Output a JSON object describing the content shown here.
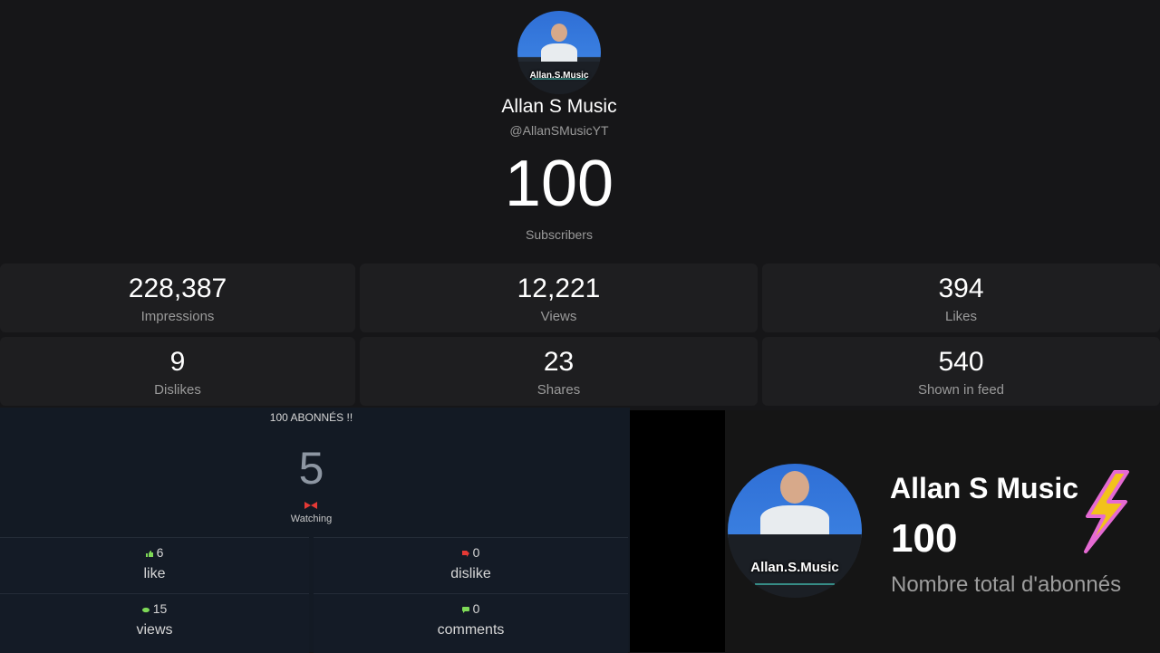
{
  "channel": {
    "name": "Allan S Music",
    "handle": "@AllanSMusicYT",
    "subscribers": "100",
    "subscribers_label": "Subscribers",
    "avatar_logo": "Allan.S.Music"
  },
  "stats": [
    {
      "value": "228,387",
      "label": "Impressions"
    },
    {
      "value": "12,221",
      "label": "Views"
    },
    {
      "value": "394",
      "label": "Likes"
    },
    {
      "value": "9",
      "label": "Dislikes"
    },
    {
      "value": "23",
      "label": "Shares"
    },
    {
      "value": "540",
      "label": "Shown in feed"
    }
  ],
  "live": {
    "title": "100 ABONNÉS !!",
    "watching_count": "5",
    "watching_label": "Watching",
    "cells": [
      {
        "value": "6",
        "label": "like",
        "icon": "thumbs-up-icon",
        "color": "#7ed957"
      },
      {
        "value": "0",
        "label": "dislike",
        "icon": "thumbs-down-icon",
        "color": "#e53935"
      },
      {
        "value": "15",
        "label": "views",
        "icon": "eye-icon",
        "color": "#7ed957"
      },
      {
        "value": "0",
        "label": "comments",
        "icon": "comment-icon",
        "color": "#7ed957"
      }
    ]
  },
  "banner": {
    "name": "Allan S Music",
    "count": "100",
    "label": "Nombre total d'abonnés",
    "icon": "lightning-bolt-icon",
    "bolt_color": "#f2c21b",
    "bolt_outline_color": "#e56ad3"
  }
}
